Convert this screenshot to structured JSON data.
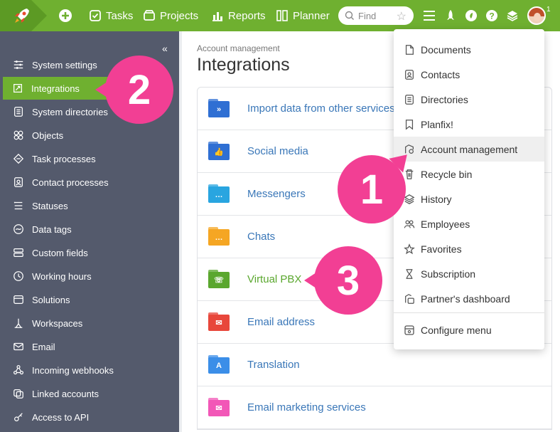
{
  "topbar": {
    "tasks": "Tasks",
    "projects": "Projects",
    "reports": "Reports",
    "planner": "Planner",
    "search_placeholder": "Find",
    "avatar_badge": "1",
    "icons": [
      "rocket-logo-icon",
      "plus-icon",
      "menu-icon",
      "rocket-icon",
      "leaf-icon",
      "help-icon",
      "layers-icon"
    ]
  },
  "sidebar": {
    "collapse": "«",
    "items": [
      {
        "label": "System settings",
        "icon": "sliders-icon"
      },
      {
        "label": "Integrations",
        "icon": "integrations-icon"
      },
      {
        "label": "System directories",
        "icon": "list-icon"
      },
      {
        "label": "Objects",
        "icon": "objects-icon"
      },
      {
        "label": "Task processes",
        "icon": "task-process-icon"
      },
      {
        "label": "Contact processes",
        "icon": "contact-process-icon"
      },
      {
        "label": "Statuses",
        "icon": "statuses-icon"
      },
      {
        "label": "Data tags",
        "icon": "data-tags-icon"
      },
      {
        "label": "Custom fields",
        "icon": "custom-fields-icon"
      },
      {
        "label": "Working hours",
        "icon": "clock-icon"
      },
      {
        "label": "Solutions",
        "icon": "solutions-icon"
      },
      {
        "label": "Workspaces",
        "icon": "workspaces-icon"
      },
      {
        "label": "Email",
        "icon": "email-icon"
      },
      {
        "label": "Incoming webhooks",
        "icon": "webhooks-icon"
      },
      {
        "label": "Linked accounts",
        "icon": "linked-accounts-icon"
      },
      {
        "label": "Access to API",
        "icon": "api-icon"
      }
    ]
  },
  "main": {
    "breadcrumb": "Account management",
    "title": "Integrations",
    "items": [
      {
        "label": "Import data from other services",
        "color": "#2f6fd3",
        "glyph": "»"
      },
      {
        "label": "Social media",
        "color": "#2f6fd3",
        "glyph": "👍"
      },
      {
        "label": "Messengers",
        "color": "#29a5e0",
        "glyph": "…"
      },
      {
        "label": "Chats",
        "color": "#f5a623",
        "glyph": "…"
      },
      {
        "label": "Virtual PBX",
        "color": "#5aa72e",
        "glyph": "☏"
      },
      {
        "label": "Email address",
        "color": "#e8473b",
        "glyph": "✉"
      },
      {
        "label": "Translation",
        "color": "#3b8ee8",
        "glyph": "A"
      },
      {
        "label": "Email marketing services",
        "color": "#f257b7",
        "glyph": "✉"
      }
    ]
  },
  "dropdown": {
    "items": [
      {
        "label": "Documents",
        "icon": "documents-icon"
      },
      {
        "label": "Contacts",
        "icon": "contacts-icon"
      },
      {
        "label": "Directories",
        "icon": "directories-icon"
      },
      {
        "label": "Planfix!",
        "icon": "bookmark-icon"
      },
      {
        "label": "Account management",
        "icon": "account-management-icon"
      },
      {
        "label": "Recycle bin",
        "icon": "trash-icon"
      },
      {
        "label": "History",
        "icon": "history-icon"
      },
      {
        "label": "Employees",
        "icon": "employees-icon"
      },
      {
        "label": "Favorites",
        "icon": "star-icon"
      },
      {
        "label": "Subscription",
        "icon": "hourglass-icon"
      },
      {
        "label": "Partner's dashboard",
        "icon": "partner-dashboard-icon"
      }
    ],
    "configure": {
      "label": "Configure menu",
      "icon": "configure-icon"
    }
  },
  "callouts": [
    "1",
    "2",
    "3"
  ],
  "colors": {
    "topbar": "#6fb030",
    "sidebar": "#545a6c",
    "accent": "#f23f94",
    "link": "#3a77b8"
  }
}
